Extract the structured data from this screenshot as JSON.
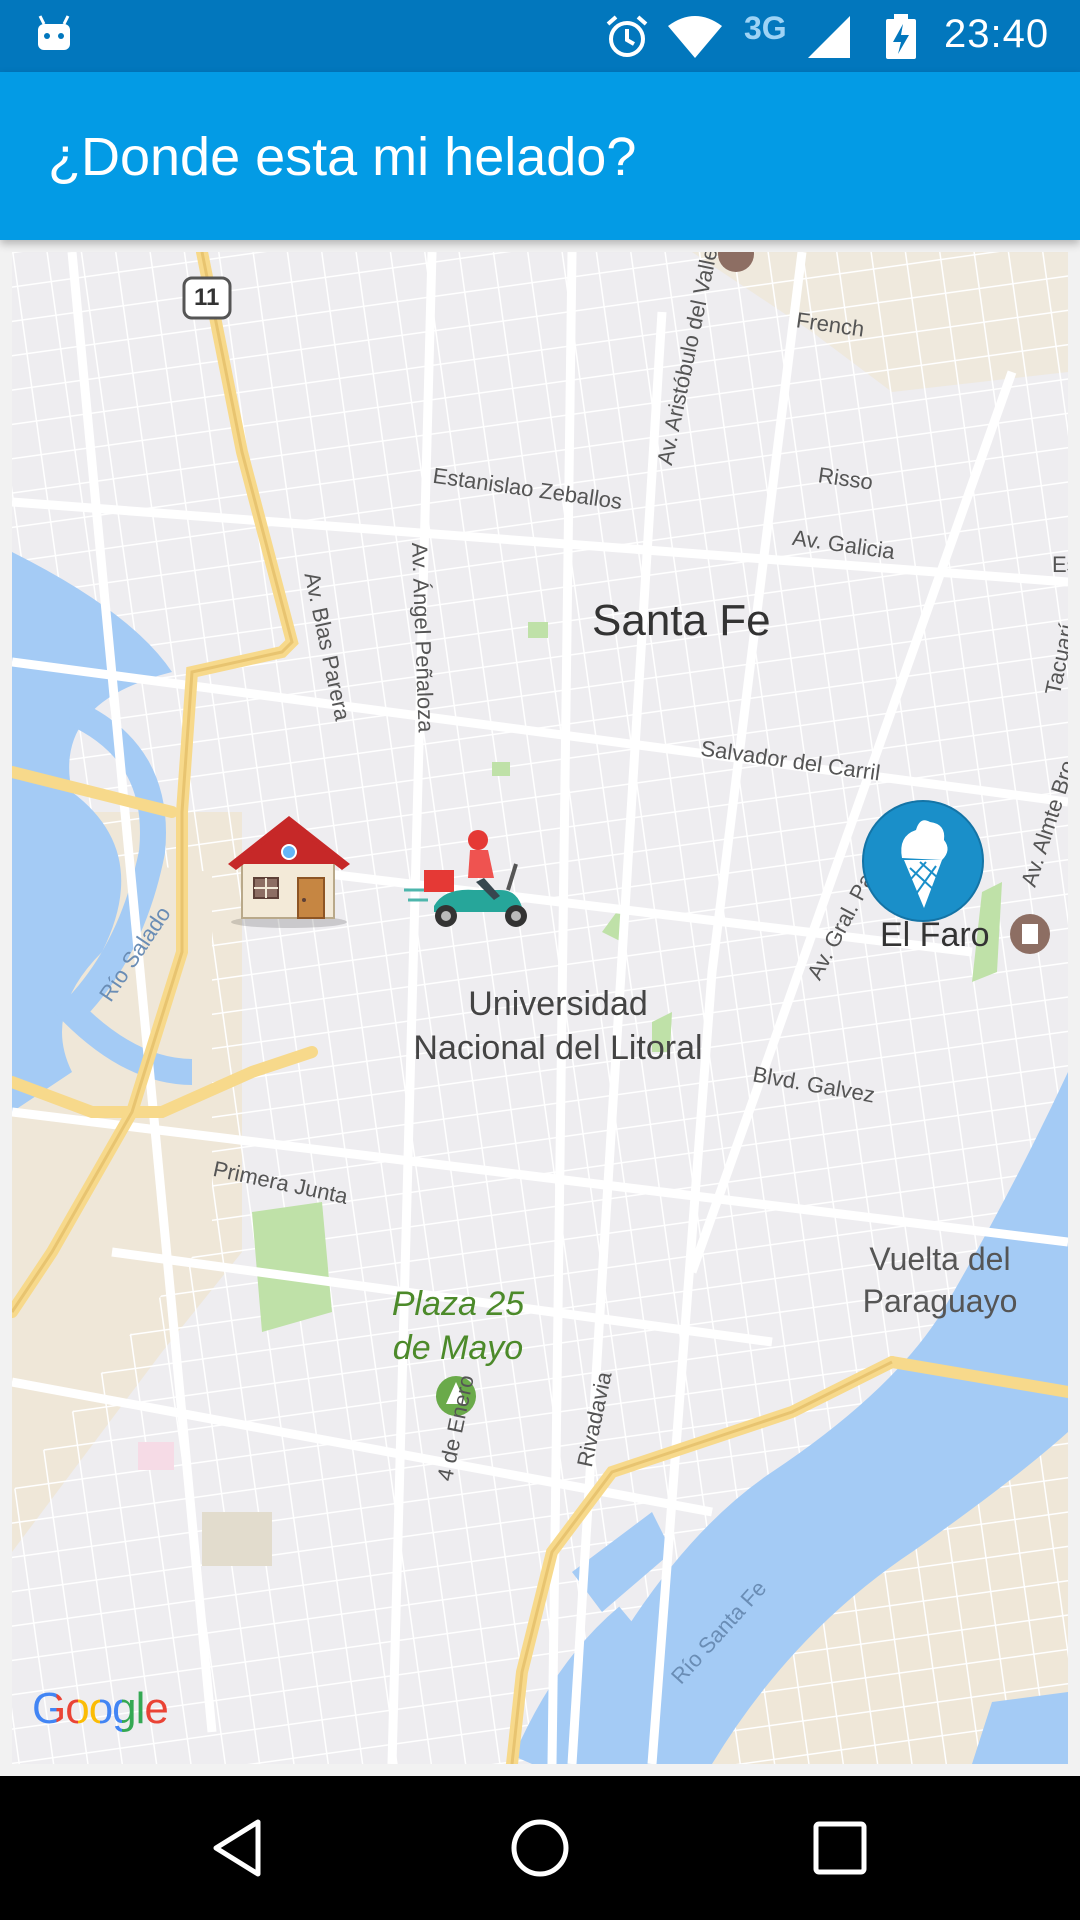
{
  "status_bar": {
    "time": "23:40",
    "network_type": "3G",
    "icons": [
      "android-icon",
      "alarm-icon",
      "wifi-icon",
      "signal-icon",
      "battery-charging-icon"
    ]
  },
  "app_bar": {
    "title": "¿Donde esta mi helado?"
  },
  "map": {
    "city_label": "Santa Fe",
    "street_labels": {
      "estanislao_zeballos": "Estanislao Zeballos",
      "french": "French",
      "risso": "Risso",
      "av_galicia": "Av. Galicia",
      "av_aristobulo_del_valle": "Av. Aristóbulo del Valle",
      "av_angel_penaloza": "Av. Ángel Peñaloza",
      "av_blas_parera": "Av. Blas Parera",
      "salvador_del_carril": "Salvador del Carril",
      "av_gral_paz": "Av. Gral. Paz",
      "tacuari": "Tacuarí",
      "av_almte_brown": "Av. Almte Bro",
      "blvd_galvez": "Blvd. Galvez",
      "primera_junta": "Primera Junta",
      "cuatro_de_enero": "4 de Enero",
      "rivadavia": "Rivadavia",
      "rio_salado": "Río Salado",
      "rio_santa_fe": "Río Santa Fe",
      "route_11": "11",
      "edge_es": "Es"
    },
    "poi_labels": {
      "el_faro": "El Faro",
      "universidad_line1": "Universidad",
      "universidad_line2": "Nacional del Litoral",
      "plaza_line1": "Plaza 25",
      "plaza_line2": "de Mayo",
      "vuelta_line1": "Vuelta del",
      "vuelta_line2": "Paraguayo"
    },
    "markers": [
      "home-marker-icon",
      "delivery-scooter-icon",
      "ice-cream-shop-icon"
    ],
    "attribution": "Google",
    "colors": {
      "water": "#a4cbf5",
      "land": "#eeedf0",
      "riverbank": "#efe7d8",
      "highway": "#f7d98b",
      "park": "#bfe1a8",
      "street": "#ffffff"
    }
  }
}
